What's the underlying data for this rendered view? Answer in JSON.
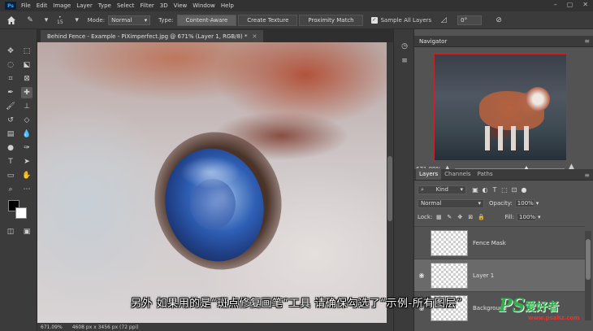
{
  "menu": {
    "app_logo": "Ps",
    "items": [
      "File",
      "Edit",
      "Image",
      "Layer",
      "Type",
      "Select",
      "Filter",
      "3D",
      "View",
      "Window",
      "Help"
    ]
  },
  "options_bar": {
    "brush_size": "15",
    "mode_label": "Mode:",
    "mode_value": "Normal",
    "type_label": "Type:",
    "type_buttons": [
      "Content-Aware",
      "Create Texture",
      "Proximity Match"
    ],
    "sample_all_layers": "Sample All Layers",
    "angle_value": "0°"
  },
  "document": {
    "tab_title": "Behind Fence - Example - PiXimperfect.jpg @ 671% (Layer 1, RGB/8) *",
    "status_zoom": "671.09%",
    "status_size": "4608 px x 3456 px (72 ppi)"
  },
  "navigator": {
    "title": "Navigator",
    "zoom": "671.09%",
    "zoom_fraction": 0.65
  },
  "layers": {
    "tabs": [
      "Layers",
      "Channels",
      "Paths"
    ],
    "kind_label": "Kind",
    "blend_mode": "Normal",
    "opacity_label": "Opacity:",
    "opacity_value": "100%",
    "lock_label": "Lock:",
    "fill_label": "Fill:",
    "fill_value": "100%",
    "items": [
      {
        "name": "Fence Mask",
        "visible": false,
        "selected": false
      },
      {
        "name": "Layer 1",
        "visible": true,
        "selected": true
      },
      {
        "name": "Background",
        "visible": true,
        "selected": false
      }
    ]
  },
  "subtitle": "另外 如果用的是“斑点修复画笔”工具 请确保勾选了“示例-所有图层”",
  "watermark": {
    "logo": "PS",
    "name": "爱好者",
    "url": "www.psahz.com"
  },
  "colors": {
    "accent": "#31a8ff",
    "watermark_green": "#2fb04a",
    "watermark_red": "#e8342e"
  }
}
